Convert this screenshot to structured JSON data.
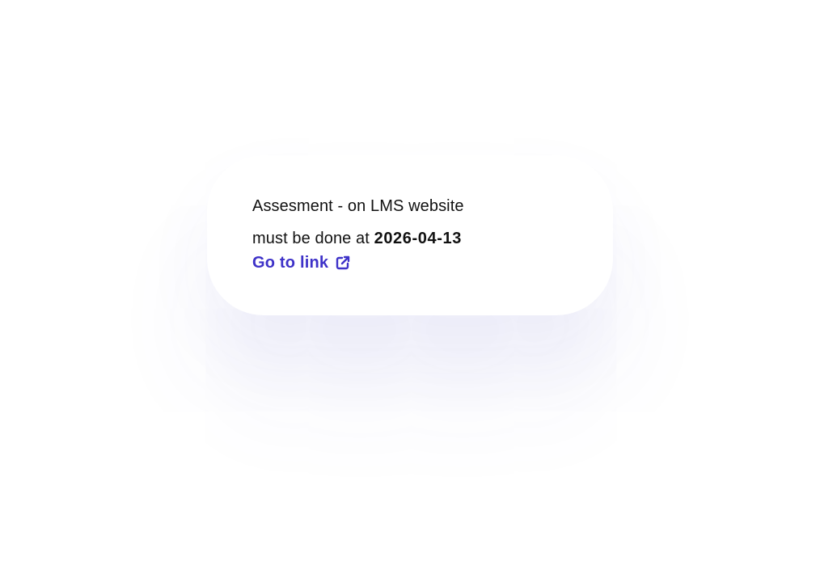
{
  "card": {
    "title": "Assesment - on LMS website",
    "due_prefix": "must be done at",
    "due_date": "2026-04-13",
    "link_label": "Go to link",
    "link_icon": "external-link-icon",
    "link_color": "#3e32c8"
  }
}
